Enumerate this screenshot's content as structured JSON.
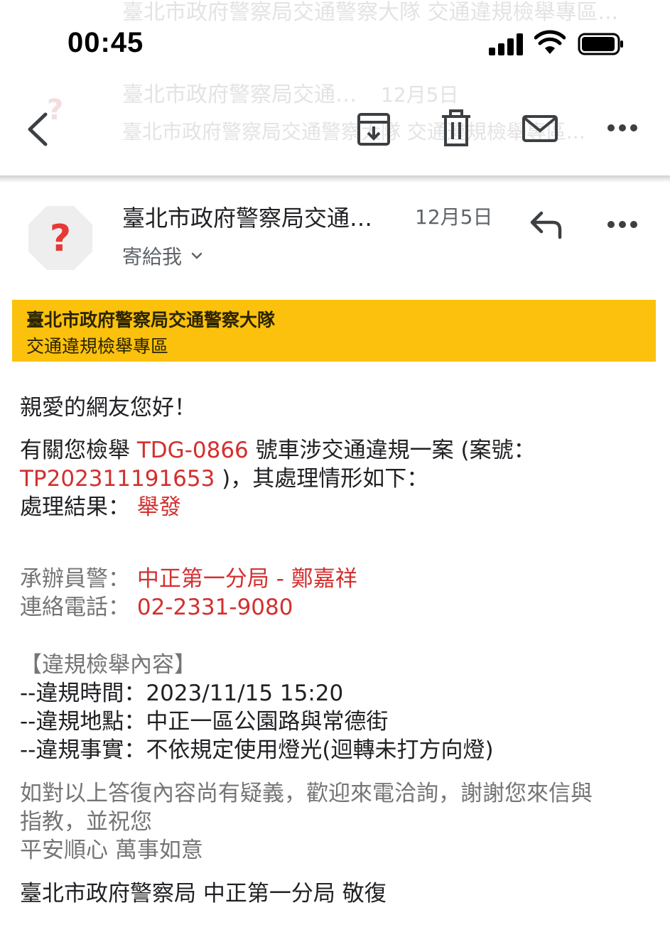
{
  "status_bar": {
    "time": "00:45"
  },
  "ghost_list": {
    "row1": "臺北市政府警察局交通警察大隊 交通違規檢舉專區...",
    "row2_sender": "臺北市政府警察局交通…",
    "row2_date": "12月5日",
    "row3": "臺北市政府警察局交通警察大隊 交通違規檢舉專區..."
  },
  "message": {
    "sender": "臺北市政府警察局交通…",
    "date": "12月5日",
    "recipient": "寄給我",
    "avatar_glyph": "?"
  },
  "banner": {
    "title": "臺北市政府警察局交通警察大隊",
    "subtitle": "交通違規檢舉專區"
  },
  "body": {
    "greeting": "親愛的網友您好！",
    "l1_pre": "有關您檢舉 ",
    "plate": "TDG-0866",
    "l1_post": " 號車涉交通違規一案 (案號：",
    "case_no": "TP202311191653",
    "l2_post": " )，其處理情形如下：",
    "result_label": "處理結果：",
    "result_value": " 舉發",
    "officer_label": "承辦員警：",
    "officer_value": " 中正第一分局 - 鄭嘉祥",
    "phone_label": "連絡電話：",
    "phone_value": " 02-2331-9080",
    "section_title": "【違規檢舉內容】",
    "time_line": "--違規時間：2023/11/15 15:20",
    "place_line": "--違規地點：中正一區公園路與常德街",
    "fact_line": "--違規事實：不依規定使用燈光(迴轉未打方向燈)",
    "closing_1": "如對以上答復內容尚有疑義，歡迎來電洽詢，謝謝您來信與",
    "closing_2": "指教，並祝您",
    "closing_3": "平安順心 萬事如意",
    "signature": "臺北市政府警察局 中正第一分局 敬復"
  },
  "colors": {
    "accent_red": "#d32f2f",
    "banner_yellow": "#fbc10c"
  }
}
